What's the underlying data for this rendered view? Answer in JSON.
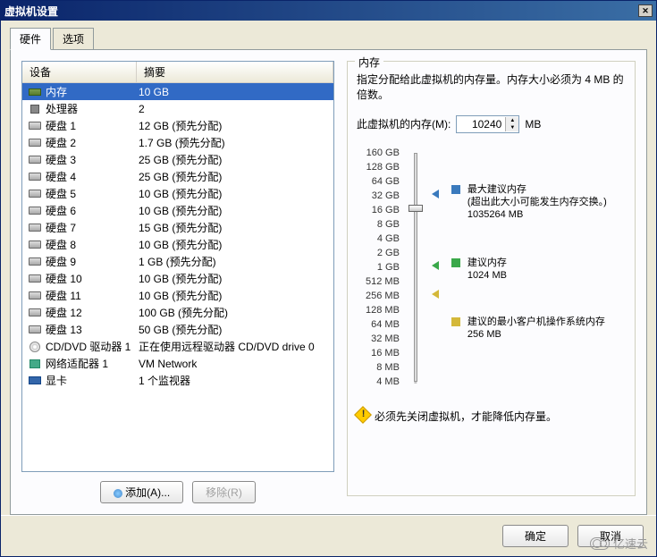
{
  "window": {
    "title": "虚拟机设置"
  },
  "tabs": {
    "hardware": "硬件",
    "options": "选项"
  },
  "list": {
    "header_device": "设备",
    "header_summary": "摘要",
    "rows": [
      {
        "icon": "mem",
        "name": "内存",
        "summary": "10 GB",
        "selected": true
      },
      {
        "icon": "cpu",
        "name": "处理器",
        "summary": "2"
      },
      {
        "icon": "hdd",
        "name": "硬盘 1",
        "summary": "12 GB (预先分配)"
      },
      {
        "icon": "hdd",
        "name": "硬盘 2",
        "summary": "1.7 GB (预先分配)"
      },
      {
        "icon": "hdd",
        "name": "硬盘 3",
        "summary": "25 GB (预先分配)"
      },
      {
        "icon": "hdd",
        "name": "硬盘 4",
        "summary": "25 GB (预先分配)"
      },
      {
        "icon": "hdd",
        "name": "硬盘 5",
        "summary": "10 GB (预先分配)"
      },
      {
        "icon": "hdd",
        "name": "硬盘 6",
        "summary": "10 GB (预先分配)"
      },
      {
        "icon": "hdd",
        "name": "硬盘 7",
        "summary": "15 GB (预先分配)"
      },
      {
        "icon": "hdd",
        "name": "硬盘 8",
        "summary": "10 GB (预先分配)"
      },
      {
        "icon": "hdd",
        "name": "硬盘 9",
        "summary": "1 GB (预先分配)"
      },
      {
        "icon": "hdd",
        "name": "硬盘 10",
        "summary": "10 GB (预先分配)"
      },
      {
        "icon": "hdd",
        "name": "硬盘 11",
        "summary": "10 GB (预先分配)"
      },
      {
        "icon": "hdd",
        "name": "硬盘 12",
        "summary": "100 GB (预先分配)"
      },
      {
        "icon": "hdd",
        "name": "硬盘 13",
        "summary": "50 GB (预先分配)"
      },
      {
        "icon": "cd",
        "name": "CD/DVD 驱动器 1",
        "summary": "正在使用远程驱动器 CD/DVD drive 0"
      },
      {
        "icon": "net",
        "name": "网络适配器 1",
        "summary": "VM Network"
      },
      {
        "icon": "gpu",
        "name": "显卡",
        "summary": "1 个监视器"
      }
    ]
  },
  "buttons": {
    "add": "添加(A)...",
    "remove": "移除(R)",
    "ok": "确定",
    "cancel": "取消"
  },
  "memory": {
    "group_title": "内存",
    "desc": "指定分配给此虚拟机的内存量。内存大小必须为 4 MB 的倍数。",
    "field_label": "此虚拟机的内存(M):",
    "value": "10240",
    "unit": "MB",
    "ticks": [
      "160 GB",
      "128 GB",
      "64 GB",
      "32 GB",
      "16 GB",
      "8 GB",
      "4 GB",
      "2 GB",
      "1 GB",
      "512 MB",
      "256 MB",
      "128 MB",
      "64 MB",
      "32 MB",
      "16 MB",
      "8 MB",
      "4 MB"
    ],
    "marker_max_label": "最大建议内存",
    "marker_max_note": "(超出此大小可能发生内存交换。)",
    "marker_max_value": "1035264 MB",
    "marker_rec_label": "建议内存",
    "marker_rec_value": "1024 MB",
    "marker_min_label": "建议的最小客户机操作系统内存",
    "marker_min_value": "256 MB",
    "warning": "必须先关闭虚拟机，才能降低内存量。"
  },
  "watermark": "亿速云"
}
